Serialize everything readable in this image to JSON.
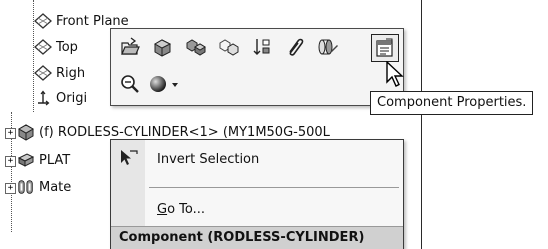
{
  "tree": {
    "items": [
      {
        "label": "Front Plane",
        "icon": "plane-icon"
      },
      {
        "label": "Top",
        "icon": "plane-icon"
      },
      {
        "label": "Righ",
        "icon": "plane-icon"
      },
      {
        "label": "Origi",
        "icon": "origin-icon"
      },
      {
        "label": "(f) RODLESS-CYLINDER<1> (MY1M50G-500L",
        "icon": "assembly-component-icon"
      },
      {
        "label": "PLAT",
        "icon": "part-component-icon"
      },
      {
        "label": "Mate",
        "icon": "mates-icon"
      }
    ]
  },
  "toolbar": {
    "row1_icons": [
      "open-part-icon",
      "edit-component-icon",
      "assembly-structure-icon",
      "hide-components-icon",
      "sort-icon",
      "clip-icon",
      "change-transparency-icon",
      "component-properties-icon"
    ],
    "row2_icons": [
      "zoom-to-selection-icon",
      "appearance-icon"
    ]
  },
  "tooltip": {
    "text": "Component Properties."
  },
  "context_menu": {
    "invert_selection": "Invert Selection",
    "go_to_prefix": "G",
    "go_to_rest": "o To...",
    "footer": "Component (RODLESS-CYLINDER)"
  }
}
